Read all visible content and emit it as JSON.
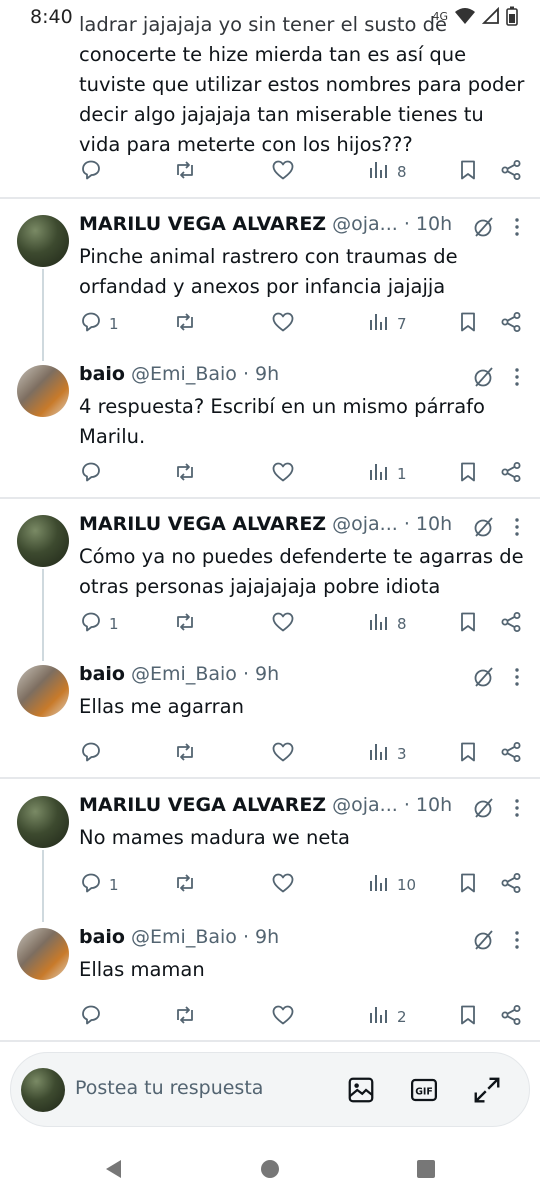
{
  "status": {
    "time": "8:40",
    "network": "4G"
  },
  "top_tweet": {
    "first_line": "ladrar jajajaja yo sin tener el susto de",
    "rest": "conocerte te hize mierda tan es así que tuviste que utilizar estos nombres para poder decir algo jajajaja tan miserable tienes tu vida para meterte con los hijos???",
    "replies": "",
    "views": "8"
  },
  "tweets": [
    {
      "name": "MARILU VEGA ALVAREZ",
      "meta": "@oja... · 10h",
      "text": "Pinche animal rastrero con traumas de orfandad y anexos por infancia jajajja",
      "replies": "1",
      "views": "7"
    },
    {
      "name": "baio",
      "meta": "@Emi_Baio · 9h",
      "text": "4 respuesta? Escribí en un mismo párrafo Marilu.",
      "replies": "",
      "views": "1"
    },
    {
      "name": "MARILU VEGA ALVAREZ",
      "meta": "@oja... · 10h",
      "text": "Cómo ya no puedes defenderte te agarras de otras personas jajajajaja pobre idiota",
      "replies": "1",
      "views": "8"
    },
    {
      "name": "baio",
      "meta": "@Emi_Baio · 9h",
      "text": "Ellas me agarran",
      "replies": "",
      "views": "3"
    },
    {
      "name": "MARILU VEGA ALVAREZ",
      "meta": "@oja... · 10h",
      "text": "No mames madura we neta",
      "replies": "1",
      "views": "10"
    },
    {
      "name": "baio",
      "meta": "@Emi_Baio · 9h",
      "text": "Ellas maman",
      "replies": "",
      "views": "2"
    }
  ],
  "compose": {
    "placeholder": "Postea tu respuesta"
  },
  "icons": [
    "reply-icon",
    "retweet-icon",
    "like-icon",
    "views-icon",
    "bookmark-icon",
    "share-icon",
    "grok-icon",
    "more-icon",
    "image-icon",
    "gif-icon",
    "expand-icon",
    "back-icon",
    "home-icon",
    "recents-icon"
  ],
  "colors": {
    "icon_gray": "#536471",
    "text": "#0f1419",
    "divider": "#e6e8eb",
    "thread_line": "#cfd9de"
  }
}
